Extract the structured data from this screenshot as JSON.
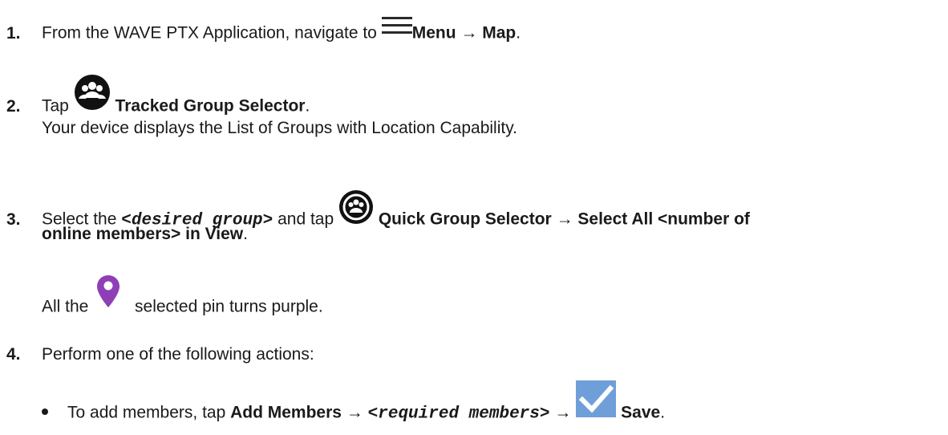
{
  "steps": [
    {
      "num": "1.",
      "pre": "From the WAVE PTX Application, navigate to ",
      "icon": "menu-icon",
      "b1": "Menu",
      "arrow": " → ",
      "b2": "Map",
      "end": "."
    },
    {
      "num": "2.",
      "pre": "Tap ",
      "icon": "group-selector-icon",
      "b1": "Tracked Group Selector",
      "end": ".",
      "result": "Your device displays the List of Groups with Location Capability."
    },
    {
      "num": "3.",
      "pre": "Select the ",
      "mono": "<desired group>",
      "mid": " and tap ",
      "icon": "quick-group-selector-icon",
      "b1": "Quick Group Selector",
      "arrow": " → ",
      "b2a": "Select All <number of",
      "b2b": "online members> in View",
      "end": ".",
      "result_pre": "All the ",
      "result_icon": "location-pin-icon",
      "result_post": " selected pin turns purple."
    },
    {
      "num": "4.",
      "text": "Perform one of the following actions:",
      "bullet": {
        "pre": "To add members, tap ",
        "b1": "Add Members",
        "arrow1": " → ",
        "mono": "<required members>",
        "arrow2": " → ",
        "icon": "checkmark-icon",
        "b2": "Save",
        "end": "."
      }
    }
  ],
  "colors": {
    "text": "#1a1a1a",
    "pin": "#8e3fb8",
    "check_bg": "#6f9fd8",
    "icon_dark": "#111111"
  }
}
